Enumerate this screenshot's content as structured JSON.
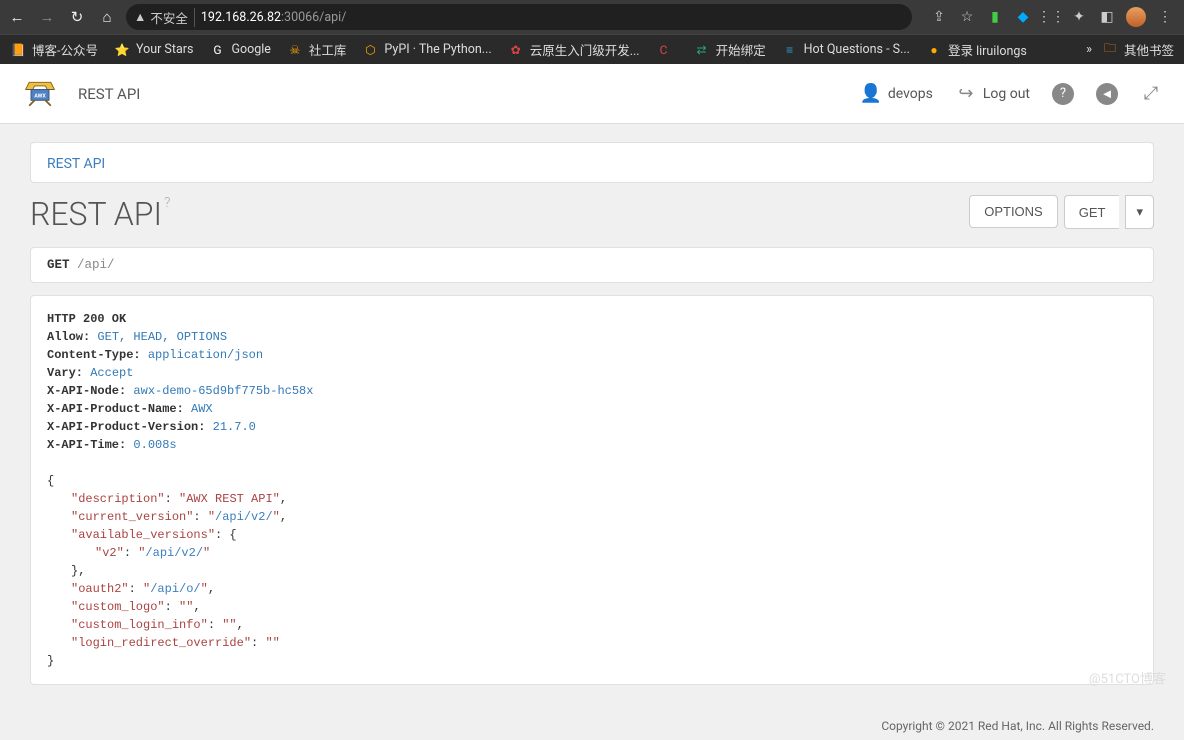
{
  "browser": {
    "security_label": "不安全",
    "url_host": "192.168.26.82",
    "url_rest": ":30066/api/"
  },
  "bookmarks": [
    {
      "icon": "📙",
      "label": "博客-公众号"
    },
    {
      "icon": "⭐",
      "label": "Your Stars"
    },
    {
      "icon": "G",
      "label": "Google",
      "color": "#fff"
    },
    {
      "icon": "☠",
      "label": "社工库"
    },
    {
      "icon": "⬡",
      "label": "PyPI · The Python..."
    },
    {
      "icon": "✿",
      "label": "云原生入门级开发...",
      "color": "#d44"
    },
    {
      "icon": "C",
      "label": "",
      "color": "#d44"
    },
    {
      "icon": "⇄",
      "label": "开始绑定",
      "color": "#2a7"
    },
    {
      "icon": "≡",
      "label": "Hot Questions - S...",
      "color": "#39c"
    },
    {
      "icon": "●",
      "label": "登录 liruilongs",
      "color": "#fa0"
    }
  ],
  "bm_more": "»",
  "bm_folder": "其他书签",
  "header": {
    "title": "REST API",
    "user": "devops",
    "logout": "Log out"
  },
  "breadcrumb": "REST API",
  "page_title": "REST API",
  "buttons": {
    "options": "OPTIONS",
    "get": "GET"
  },
  "request": {
    "method": "GET",
    "path": "/api/"
  },
  "response": {
    "status": "HTTP 200 OK",
    "headers": [
      {
        "k": "Allow:",
        "v": "GET, HEAD, OPTIONS"
      },
      {
        "k": "Content-Type:",
        "v": "application/json"
      },
      {
        "k": "Vary:",
        "v": "Accept"
      },
      {
        "k": "X-API-Node:",
        "v": "awx-demo-65d9bf775b-hc58x"
      },
      {
        "k": "X-API-Product-Name:",
        "v": "AWX"
      },
      {
        "k": "X-API-Product-Version:",
        "v": "21.7.0"
      },
      {
        "k": "X-API-Time:",
        "v": "0.008s"
      }
    ],
    "body": {
      "description": "AWX REST API",
      "current_version": "/api/v2/",
      "available_versions": {
        "v2": "/api/v2/"
      },
      "oauth2": "/api/o/",
      "custom_logo": "",
      "custom_login_info": "",
      "login_redirect_override": ""
    }
  },
  "footer": "Copyright © 2021 Red Hat, Inc. All Rights Reserved.",
  "watermark": "@51CTO博客"
}
